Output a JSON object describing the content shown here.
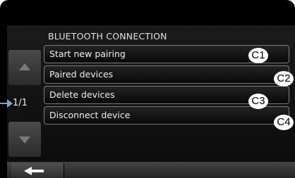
{
  "screen": {
    "title": "BLUETOOTH CONNECTION",
    "page_indicator": "1/1"
  },
  "menu": {
    "items": [
      {
        "label": "Start new pairing",
        "callout": "C1"
      },
      {
        "label": "Paired devices",
        "callout": "C2"
      },
      {
        "label": "Delete devices",
        "callout": "C3"
      },
      {
        "label": "Disconnect device",
        "callout": "C4"
      }
    ]
  },
  "icons": {
    "scroll_up": "triangle-up-icon",
    "scroll_down": "triangle-down-icon",
    "back": "left-arrow-icon",
    "pointer": "arrow-pointer-icon"
  },
  "colors": {
    "background": "#000000",
    "text": "#f0f0f0",
    "button_border": "#7e7e7e",
    "pointer": "#79a7dd"
  }
}
